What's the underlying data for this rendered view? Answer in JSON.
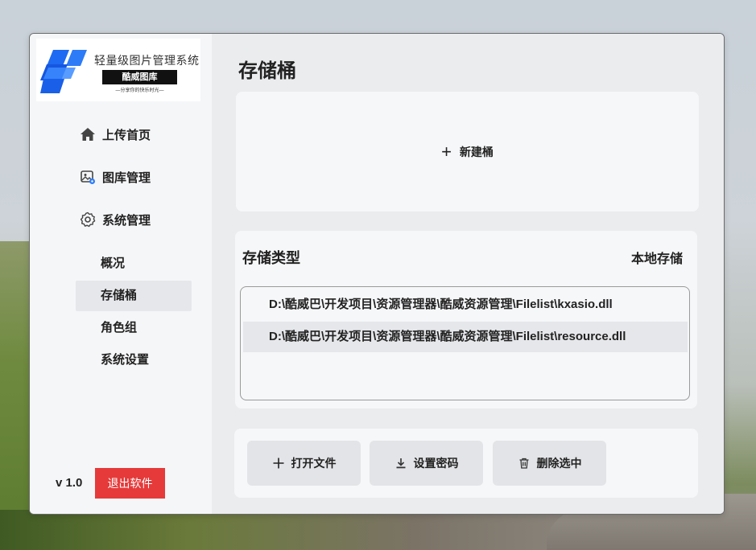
{
  "sidebar": {
    "logo": {
      "title": "轻量级图片管理系统",
      "badge": "酷威图库",
      "slogan": "—分享你的快乐时光—"
    },
    "nav": [
      {
        "label": "上传首页",
        "icon": "home-icon"
      },
      {
        "label": "图库管理",
        "icon": "gallery-icon"
      },
      {
        "label": "系统管理",
        "icon": "gear-icon"
      }
    ],
    "sub_items": [
      {
        "label": "概况"
      },
      {
        "label": "存储桶",
        "active": true
      },
      {
        "label": "角色组"
      },
      {
        "label": "系统设置"
      }
    ],
    "version": "v 1.0",
    "exit_label": "退出软件"
  },
  "main": {
    "title": "存储桶",
    "new_bucket_label": "新建桶",
    "storage_type_label": "存储类型",
    "storage_type_value": "本地存储",
    "files": [
      "D:\\酷威巴\\开发项目\\资源管理器\\酷威资源管理\\Filelist\\kxasio.dll",
      "D:\\酷威巴\\开发项目\\资源管理器\\酷威资源管理\\Filelist\\resource.dll"
    ],
    "actions": {
      "open_file": "打开文件",
      "set_password": "设置密码",
      "delete_selected": "删除选中"
    }
  },
  "colors": {
    "accent_blue": "#1f6cf0",
    "danger_red": "#e63a3a",
    "selected_bg": "#e6e7ea"
  }
}
